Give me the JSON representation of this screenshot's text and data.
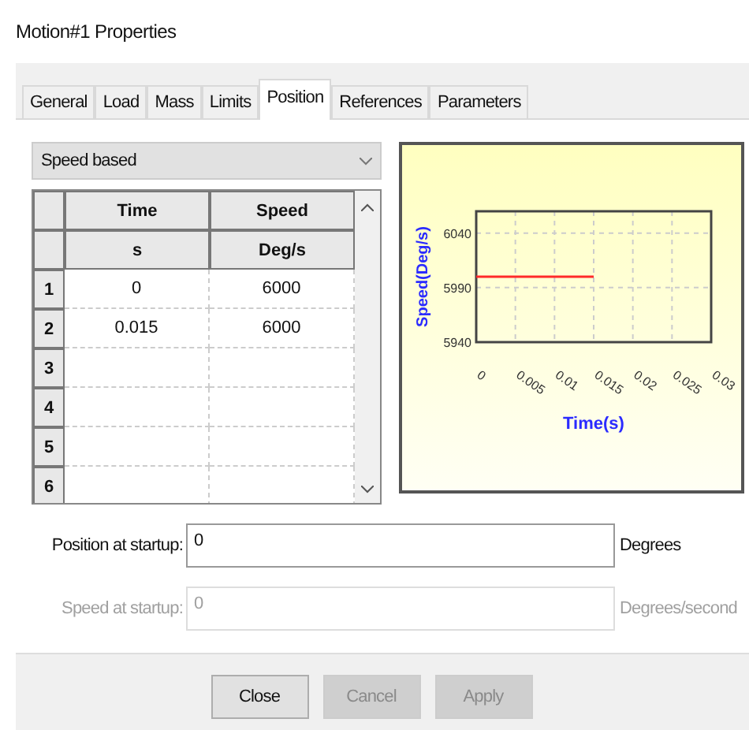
{
  "window": {
    "title": "Motion#1 Properties"
  },
  "tabs": [
    {
      "label": "General",
      "selected": false
    },
    {
      "label": "Load",
      "selected": false
    },
    {
      "label": "Mass",
      "selected": false
    },
    {
      "label": "Limits",
      "selected": false
    },
    {
      "label": "Position",
      "selected": true
    },
    {
      "label": "References",
      "selected": false
    },
    {
      "label": "Parameters",
      "selected": false
    }
  ],
  "mode_dropdown": {
    "value": "Speed based"
  },
  "table": {
    "columns": [
      "Time",
      "Speed"
    ],
    "units": [
      "s",
      "Deg/s"
    ],
    "rows": [
      {
        "index": "1",
        "cells": [
          "0",
          "6000"
        ]
      },
      {
        "index": "2",
        "cells": [
          "0.015",
          "6000"
        ]
      },
      {
        "index": "3",
        "cells": [
          "",
          ""
        ]
      },
      {
        "index": "4",
        "cells": [
          "",
          ""
        ]
      },
      {
        "index": "5",
        "cells": [
          "",
          ""
        ]
      },
      {
        "index": "6",
        "cells": [
          "",
          ""
        ]
      }
    ]
  },
  "chart": {
    "chart_data": {
      "type": "line",
      "xlabel": "Time(s)",
      "ylabel": "Speed(Deg/s)",
      "x": [
        0,
        0.015
      ],
      "series": [
        {
          "color": "#ff2a2a",
          "values": [
            6000,
            6000
          ]
        }
      ],
      "grid": true,
      "xlim": [
        0,
        0.03
      ],
      "ylim": [
        5940,
        6060
      ],
      "xticks": [
        {
          "value": 0,
          "label": "0"
        },
        {
          "value": 0.005,
          "label": "0.005"
        },
        {
          "value": 0.01,
          "label": "0.01"
        },
        {
          "value": 0.015,
          "label": "0.015"
        },
        {
          "value": 0.02,
          "label": "0.02"
        },
        {
          "value": 0.025,
          "label": "0.025"
        },
        {
          "value": 0.03,
          "label": "0.03"
        }
      ],
      "yticks": [
        5940,
        5990,
        6040
      ]
    }
  },
  "fields": [
    {
      "label": "Position at startup:",
      "value": "0",
      "unit": "Degrees",
      "disabled": false
    },
    {
      "label": "Speed at startup:",
      "value": "0",
      "unit": "Degrees/second",
      "disabled": true
    }
  ],
  "buttons": [
    {
      "label": "Close",
      "disabled": false
    },
    {
      "label": "Cancel",
      "disabled": true
    },
    {
      "label": "Apply",
      "disabled": true
    }
  ]
}
